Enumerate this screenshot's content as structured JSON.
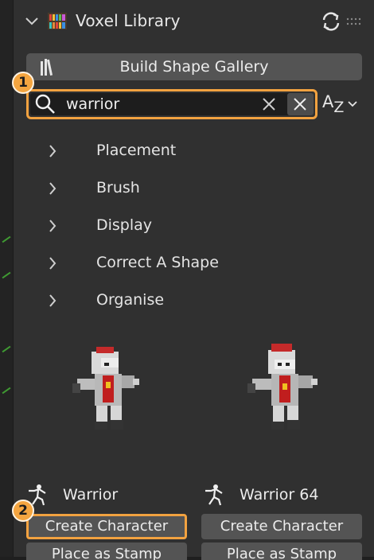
{
  "header": {
    "title": "Voxel Library",
    "refresh_icon": "refresh-icon",
    "grip_icon": "drag-grip-icon"
  },
  "gallery_button": {
    "label": "Build Shape Gallery",
    "icon": "books-icon"
  },
  "search": {
    "value": "warrior",
    "icon": "search-icon",
    "clear_icon": "close-icon"
  },
  "sort": {
    "label": "A",
    "label_sub": "Z",
    "icon": "sort-alpha-icon"
  },
  "badges": [
    "1",
    "2"
  ],
  "sections": [
    "Placement",
    "Brush",
    "Display",
    "Correct A Shape",
    "Organise"
  ],
  "items": [
    {
      "name": "Warrior",
      "create_label": "Create Character",
      "stamp_label": "Place as Stamp",
      "icon": "character-pose-icon"
    },
    {
      "name": "Warrior 64",
      "create_label": "Create Character",
      "stamp_label": "Place as Stamp",
      "icon": "character-pose-icon"
    }
  ],
  "colors": {
    "accent": "#f2a240",
    "panel": "#303030",
    "button": "#545454",
    "field": "#1d1d1d"
  }
}
